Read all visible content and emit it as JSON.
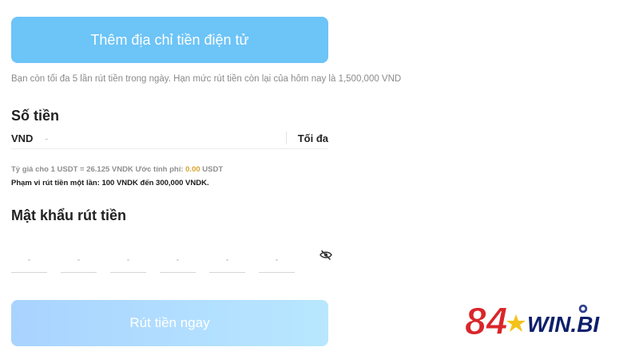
{
  "add_address_button": {
    "label": "Thêm địa chỉ tiền điện tử"
  },
  "limit_note": "Bạn còn tối đa 5 lần rút tiền trong ngày. Hạn mức rút tiền còn lại của hôm nay là 1,500,000 VND",
  "amount": {
    "title": "Số tiền",
    "currency": "VND",
    "placeholder": "-",
    "max_label": "Tối đa"
  },
  "rate_info": {
    "prefix": "Tỷ giá cho 1 USDT = 26.125 VNDK Ước tính phí: ",
    "fee": "0.00",
    "suffix": " USDT",
    "fee_color": "#d7a531"
  },
  "range_info": "Phạm vi rút tiền một lần: 100 VNDK đến 300,000 VNDK.",
  "password": {
    "title": "Mật khẩu rút tiền",
    "digits": [
      "-",
      "-",
      "-",
      "-",
      "-",
      "-"
    ],
    "toggle_icon": "eye-slash-icon"
  },
  "submit_button": {
    "label": "Rút tiền ngay"
  },
  "brand": {
    "number": "84",
    "name": "WIN.BI",
    "colors": {
      "number": "#d9262a",
      "name": "#0d1f6b",
      "star": "#f3c21a",
      "chip": "#2f3f8f"
    }
  }
}
